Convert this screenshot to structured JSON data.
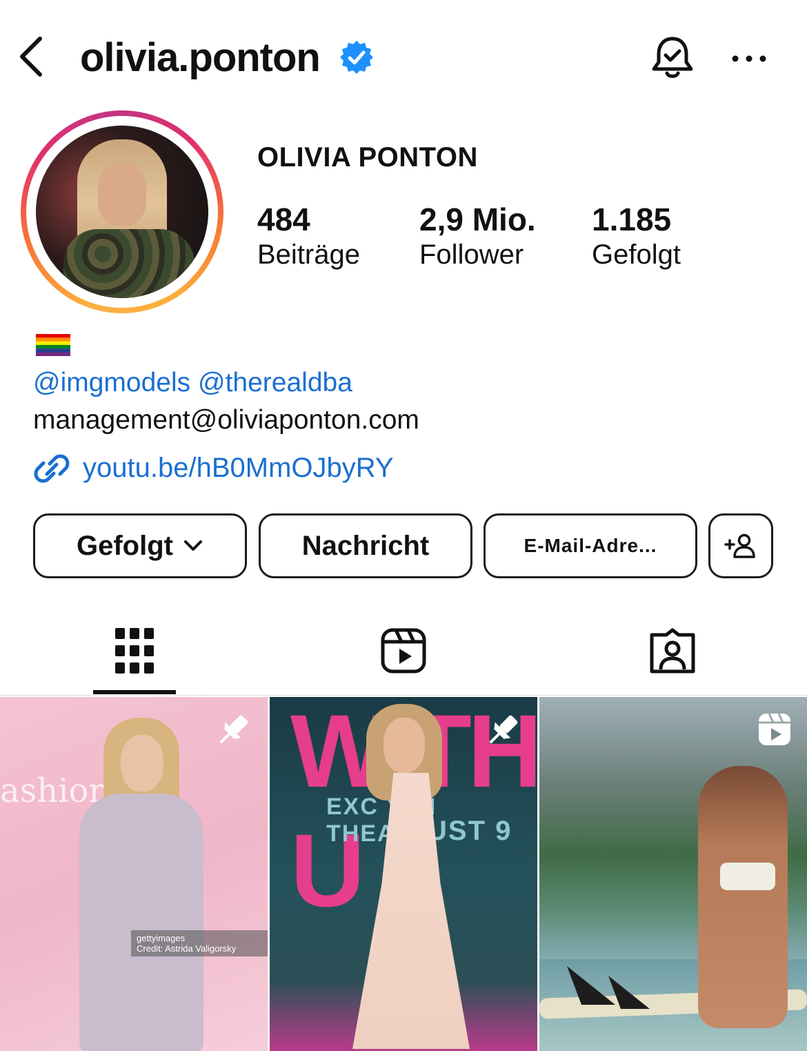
{
  "header": {
    "username": "olivia.ponton"
  },
  "profile": {
    "display_name": "OLIVIA PONTON",
    "stats": [
      {
        "value": "484",
        "label": "Beiträge"
      },
      {
        "value": "2,9 Mio.",
        "label": "Follower"
      },
      {
        "value": "1.185",
        "label": "Gefolgt"
      }
    ],
    "bio": {
      "flag": "🏳️‍🌈",
      "mentions": [
        "@imgmodels",
        "@therealdba"
      ],
      "email": "management@oliviaponton.com",
      "link": "youtu.be/hB0MmOJbyRY"
    }
  },
  "actions": {
    "following_label": "Gefolgt",
    "message_label": "Nachricht",
    "email_label": "E-Mail-Adre..."
  },
  "posts": [
    {
      "pinned": true,
      "type": "image",
      "overlay_text": "ashion",
      "credit": "gettyimages\nCredit: Astrida Valigorsky"
    },
    {
      "pinned": true,
      "type": "image",
      "overlay_title": "WITH U",
      "overlay_sub1": "EXC    Y IN THEATE",
      "overlay_sub2": "UST 9"
    },
    {
      "pinned": false,
      "type": "reel"
    }
  ],
  "colors": {
    "link_blue": "#1a6fd1",
    "verified_blue": "#1e90ff",
    "text": "#111111",
    "divider": "#dbdbdb"
  },
  "icons": {
    "back": "chevron-left-icon",
    "verified": "verified-badge-icon",
    "bell": "bell-check-icon",
    "more": "more-horizontal-icon",
    "link": "link-icon",
    "add_person": "add-person-icon",
    "grid_tab": "grid-icon",
    "reels_tab": "reels-icon",
    "tagged_tab": "tagged-icon",
    "pin": "pin-icon"
  }
}
